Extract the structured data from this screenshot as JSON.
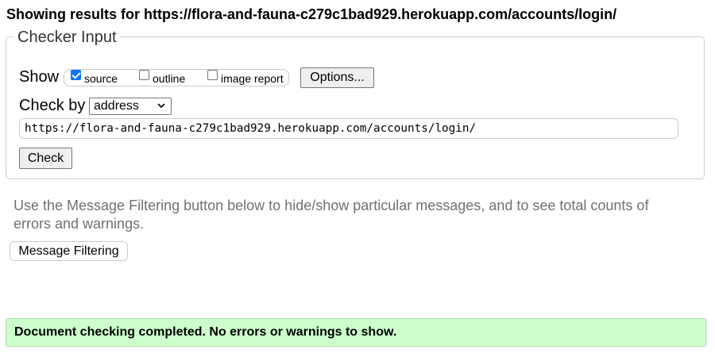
{
  "heading": {
    "prefix": "Showing results for",
    "url": "https://flora-and-fauna-c279c1bad929.herokuapp.com/accounts/login/"
  },
  "checker_input": {
    "legend": "Checker Input",
    "show_label": "Show",
    "options": [
      {
        "label": "source",
        "checked": true
      },
      {
        "label": "outline",
        "checked": false
      },
      {
        "label": "image report",
        "checked": false
      }
    ],
    "options_button": "Options...",
    "check_by_label": "Check by",
    "check_by_value": "address",
    "url_value": "https://flora-and-fauna-c279c1bad929.herokuapp.com/accounts/login/",
    "check_button": "Check"
  },
  "filter_info": "Use the Message Filtering button below to hide/show particular messages, and to see total counts of errors and warnings.",
  "message_filtering_button": "Message Filtering",
  "status_message": "Document checking completed. No errors or warnings to show.",
  "colors": {
    "success_bg": "#ccffcc",
    "checkbox_accent": "#0075ff",
    "muted_text": "#707070"
  }
}
